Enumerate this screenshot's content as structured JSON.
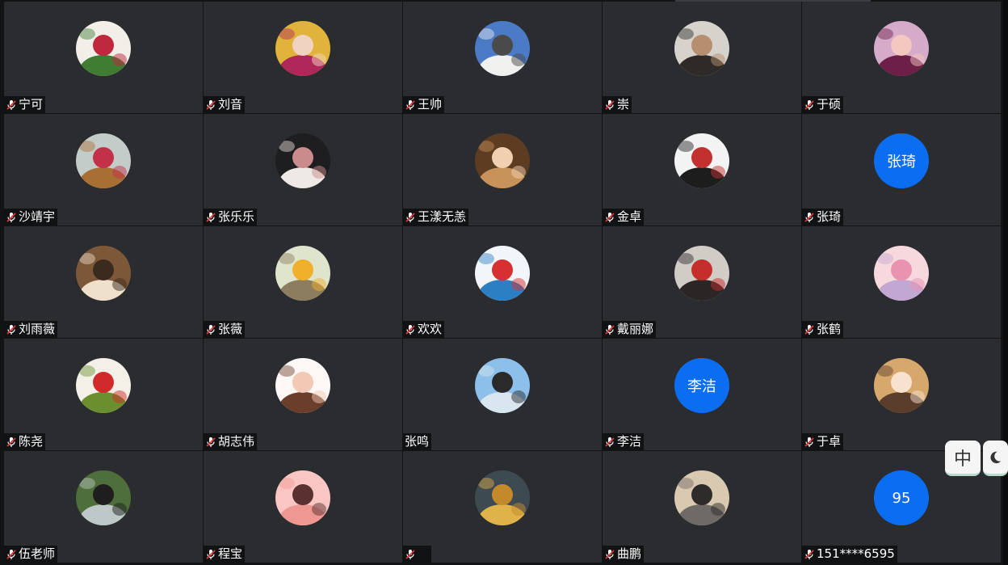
{
  "participants": [
    {
      "name": "宁可",
      "avatar": {
        "kind": "photo",
        "icon": "flowers-photo",
        "colors": [
          "#f2efe8",
          "#3f7d33",
          "#c0283e"
        ]
      },
      "muted": true
    },
    {
      "name": "刘音",
      "avatar": {
        "kind": "photo",
        "icon": "person-photo",
        "colors": [
          "#e0b43b",
          "#b0285a",
          "#f1d3c2"
        ]
      },
      "muted": true
    },
    {
      "name": "王帅",
      "avatar": {
        "kind": "photo",
        "icon": "castle-photo",
        "colors": [
          "#4b7bc7",
          "#f0f0ee",
          "#4a4a4a"
        ]
      },
      "muted": true
    },
    {
      "name": "崇",
      "avatar": {
        "kind": "photo",
        "icon": "person-photo",
        "colors": [
          "#d6d3cc",
          "#2d2a28",
          "#b58f70"
        ]
      },
      "muted": true
    },
    {
      "name": "于硕",
      "avatar": {
        "kind": "photo",
        "icon": "person-photo",
        "colors": [
          "#d6aac9",
          "#6d1f47",
          "#f2c8c0"
        ]
      },
      "muted": true
    },
    {
      "name": "沙靖宇",
      "avatar": {
        "kind": "photo",
        "icon": "person-photo",
        "colors": [
          "#c3ccc8",
          "#a86f35",
          "#c2304a"
        ]
      },
      "muted": true
    },
    {
      "name": "张乐乐",
      "avatar": {
        "kind": "photo",
        "icon": "cat-photo",
        "colors": [
          "#1e1d1f",
          "#efe9e5",
          "#c98b8b"
        ]
      },
      "muted": true
    },
    {
      "name": "王漾无恙",
      "avatar": {
        "kind": "photo",
        "icon": "person-photo",
        "colors": [
          "#5e3c22",
          "#c8935b",
          "#f0d0b0"
        ]
      },
      "muted": true
    },
    {
      "name": "金卓",
      "avatar": {
        "kind": "photo",
        "icon": "sketch-photo",
        "colors": [
          "#f3f3f3",
          "#1d1d1d",
          "#c23030"
        ]
      },
      "muted": true
    },
    {
      "name": "张琦",
      "avatar": {
        "kind": "text",
        "text": "张琦",
        "color": "#0b6ef2"
      },
      "muted": true
    },
    {
      "name": "刘雨薇",
      "avatar": {
        "kind": "photo",
        "icon": "person-photo",
        "colors": [
          "#7c5838",
          "#efe0cb",
          "#3b2a1e"
        ]
      },
      "muted": true
    },
    {
      "name": "张薇",
      "avatar": {
        "kind": "photo",
        "icon": "hedgehog-photo",
        "colors": [
          "#dfe4cc",
          "#8c7d5f",
          "#f0b02a"
        ]
      },
      "muted": true
    },
    {
      "name": "欢欢",
      "avatar": {
        "kind": "photo",
        "icon": "cartoon-photo",
        "colors": [
          "#f3f6f9",
          "#2d7fc4",
          "#d63030"
        ]
      },
      "muted": true
    },
    {
      "name": "戴丽娜",
      "avatar": {
        "kind": "photo",
        "icon": "doll-photo",
        "colors": [
          "#d2ccc7",
          "#2b2525",
          "#c62d2d"
        ]
      },
      "muted": true
    },
    {
      "name": "张鹤",
      "avatar": {
        "kind": "photo",
        "icon": "bunny-photo",
        "colors": [
          "#f6d8dd",
          "#c3a7d3",
          "#e993b1"
        ]
      },
      "muted": true
    },
    {
      "name": "陈尧",
      "avatar": {
        "kind": "photo",
        "icon": "cartoon-photo",
        "colors": [
          "#f3f0e8",
          "#6b8f2f",
          "#d02b2b"
        ]
      },
      "muted": true
    },
    {
      "name": "胡志伟",
      "avatar": {
        "kind": "photo",
        "icon": "cartoon-photo",
        "colors": [
          "#fdf8f5",
          "#6a3e2a",
          "#f1c9b5"
        ]
      },
      "muted": true
    },
    {
      "name": "张鸣",
      "avatar": {
        "kind": "photo",
        "icon": "beach-photo",
        "colors": [
          "#8cc0ea",
          "#d8e6f0",
          "#2a2a2a"
        ]
      },
      "muted": false
    },
    {
      "name": "李洁",
      "avatar": {
        "kind": "text",
        "text": "李洁",
        "color": "#0b6ef2"
      },
      "muted": true
    },
    {
      "name": "于卓",
      "avatar": {
        "kind": "photo",
        "icon": "cartoon-photo",
        "colors": [
          "#d6a86c",
          "#5a3d2a",
          "#f7e1cf"
        ]
      },
      "muted": true
    },
    {
      "name": "伍老师",
      "avatar": {
        "kind": "photo",
        "icon": "person-photo",
        "colors": [
          "#4e6f3b",
          "#bfc8c8",
          "#1e1e1e"
        ]
      },
      "muted": true
    },
    {
      "name": "程宝",
      "avatar": {
        "kind": "photo",
        "icon": "cartoon-photo",
        "colors": [
          "#f9c6c3",
          "#ef9791",
          "#5a3030"
        ]
      },
      "muted": true
    },
    {
      "name": "",
      "avatar": {
        "kind": "photo",
        "icon": "starfish-photo",
        "colors": [
          "#3e4a52",
          "#e0b24a",
          "#c48a2a"
        ]
      },
      "muted": true
    },
    {
      "name": "曲鹏",
      "avatar": {
        "kind": "photo",
        "icon": "landscape-photo",
        "colors": [
          "#d9c9b0",
          "#6f6a66",
          "#2e2c2b"
        ]
      },
      "muted": true
    },
    {
      "name": "151****6595",
      "avatar": {
        "kind": "text",
        "text": "95",
        "color": "#0b6ef2"
      },
      "muted": true
    }
  ],
  "floating": {
    "lang_label": "中",
    "theme_icon": "moon-icon"
  }
}
